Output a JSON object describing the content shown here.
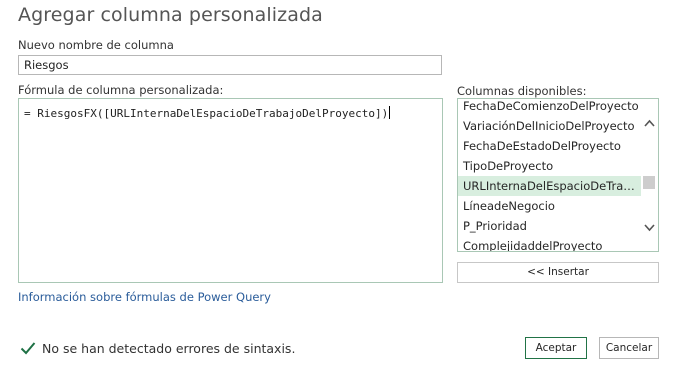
{
  "dialog": {
    "title": "Agregar columna personalizada"
  },
  "column_name": {
    "label": "Nuevo nombre de columna",
    "value": "Riesgos"
  },
  "formula": {
    "label": "Fórmula de columna personalizada:",
    "value": "= RiesgosFX([URLInternaDelEspacioDeTrabajoDelProyecto])"
  },
  "columns": {
    "label": "Columnas disponibles:",
    "items": [
      "FechaDeComienzoDelProyecto",
      "VariaciónDelInicioDelProyecto",
      "FechaDeEstadoDelProyecto",
      "TipoDeProyecto",
      "URLInternaDelEspacioDeTrabajoDelProyecto",
      "LíneadeNegocio",
      "P_Prioridad",
      "ComplejidaddelProyecto"
    ],
    "selected_index": 4,
    "insert_label": "<< Insertar"
  },
  "help_link": "Información sobre fórmulas de Power Query",
  "status": {
    "text": "No se han detectado errores de sintaxis.",
    "icon": "checkmark-icon",
    "color": "#1e7145"
  },
  "buttons": {
    "ok": "Aceptar",
    "cancel": "Cancelar"
  }
}
